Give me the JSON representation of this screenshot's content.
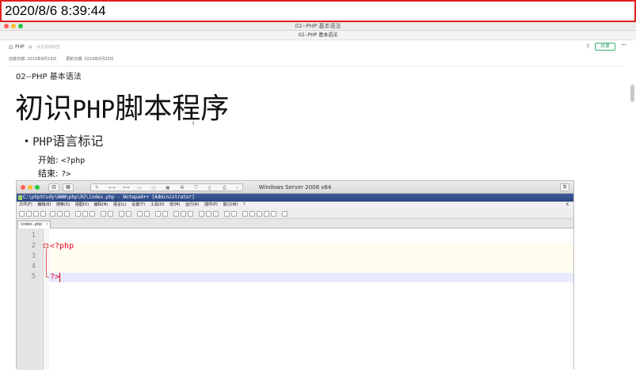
{
  "timestamp": "2020/8/6 8:39:44",
  "window": {
    "title": "02--PHP 基本语法",
    "tab_title": "02--PHP 基本语法"
  },
  "toolbar": {
    "tag": "PHP",
    "add_tag": "点击添加标签",
    "share_label": "共享",
    "more": "···"
  },
  "meta": {
    "created": "创建日期: 2019年8月19日",
    "updated": "更新日期: 2019年8月20日"
  },
  "note": {
    "title": "02--PHP 基本语法",
    "heading_cjk1": "初识",
    "heading_mono": "PHP",
    "heading_cjk2": "脚本程序",
    "bullet_mono": "PHP",
    "bullet_cjk": "语言标记",
    "start_label": "开始: ",
    "start_code": "<?php",
    "end_label": "结束: ",
    "end_code": "?>"
  },
  "vm": {
    "title": "Windows Server 2008 x64",
    "npp_title": "C:\\phpStudy\\WWW\\php\\02\\index.php - Notepad++ [Administrator]",
    "menu": [
      "文件(F)",
      "编辑(E)",
      "搜索(S)",
      "视图(V)",
      "编码(N)",
      "语言(L)",
      "设置(T)",
      "工具(O)",
      "宏(M)",
      "运行(R)",
      "插件(P)",
      "窗口(W)",
      "?"
    ],
    "menu_close": "X",
    "file_tab": "index.php",
    "lines": [
      "1",
      "2",
      "3",
      "4",
      "5"
    ],
    "code_line2": "<?php",
    "code_line5": "?>"
  },
  "colors": {
    "accent_green": "#2a9d5f",
    "timestamp_border": "#e02020",
    "code_red": "#e8002e"
  }
}
